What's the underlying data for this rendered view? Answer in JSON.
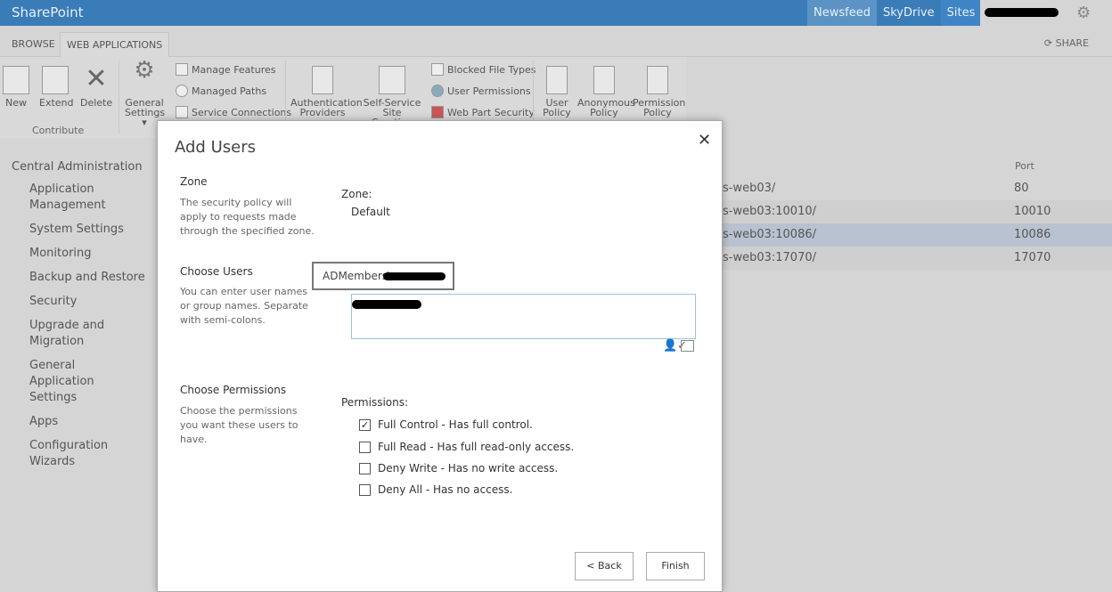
{
  "topbar": {
    "brand": "SharePoint",
    "nav": [
      "Newsfeed",
      "SkyDrive",
      "Sites"
    ],
    "settings_icon": "gear-icon"
  },
  "tabs": {
    "browse": "BROWSE",
    "web_applications": "WEB APPLICATIONS",
    "share": "SHARE"
  },
  "ribbon": {
    "new": "New",
    "extend": "Extend",
    "delete": "Delete",
    "contribute": "Contribute",
    "general_settings": [
      "General",
      "Settings"
    ],
    "manage_features": "Manage Features",
    "managed_paths": "Managed Paths",
    "service_connections": "Service Connections",
    "auth_providers": [
      "Authentication",
      "Providers"
    ],
    "self_service": [
      "Self-Service Site",
      "Creation"
    ],
    "blocked_file_types": "Blocked File Types",
    "user_permissions": "User Permissions",
    "web_part_security": "Web Part Security",
    "user_policy": [
      "User",
      "Policy"
    ],
    "anonymous_policy": [
      "Anonymous",
      "Policy"
    ],
    "permission_policy": [
      "Permission",
      "Policy"
    ]
  },
  "leftnav": {
    "root": "Central Administration",
    "items": [
      "Application Management",
      "System Settings",
      "Monitoring",
      "Backup and Restore",
      "Security",
      "Upgrade and Migration",
      "General Application Settings",
      "Apps",
      "Configuration Wizards"
    ]
  },
  "table": {
    "port_header": "Port",
    "rows": [
      {
        "url": "s-web03/",
        "port": "80"
      },
      {
        "url": "s-web03:10010/",
        "port": "10010"
      },
      {
        "url": "s-web03:10086/",
        "port": "10086"
      },
      {
        "url": "s-web03:17070/",
        "port": "17070"
      }
    ]
  },
  "dialog": {
    "title": "Add Users",
    "zone": {
      "heading": "Zone",
      "desc": "The security policy will apply to requests made through the specified zone.",
      "label": "Zone:",
      "value": "Default"
    },
    "users": {
      "heading": "Choose Users",
      "desc": "You can enter user names or group names. Separate with semi-colons.",
      "tooltip": "ADMembers\\"
    },
    "permissions": {
      "heading": "Choose Permissions",
      "desc": "Choose the permissions you want these users to have.",
      "label": "Permissions:",
      "options": [
        {
          "label": "Full Control - Has full control.",
          "checked": true
        },
        {
          "label": "Full Read - Has full read-only access.",
          "checked": false
        },
        {
          "label": "Deny Write - Has no write access.",
          "checked": false
        },
        {
          "label": "Deny All - Has no access.",
          "checked": false
        }
      ]
    },
    "back": "< Back",
    "finish": "Finish"
  }
}
